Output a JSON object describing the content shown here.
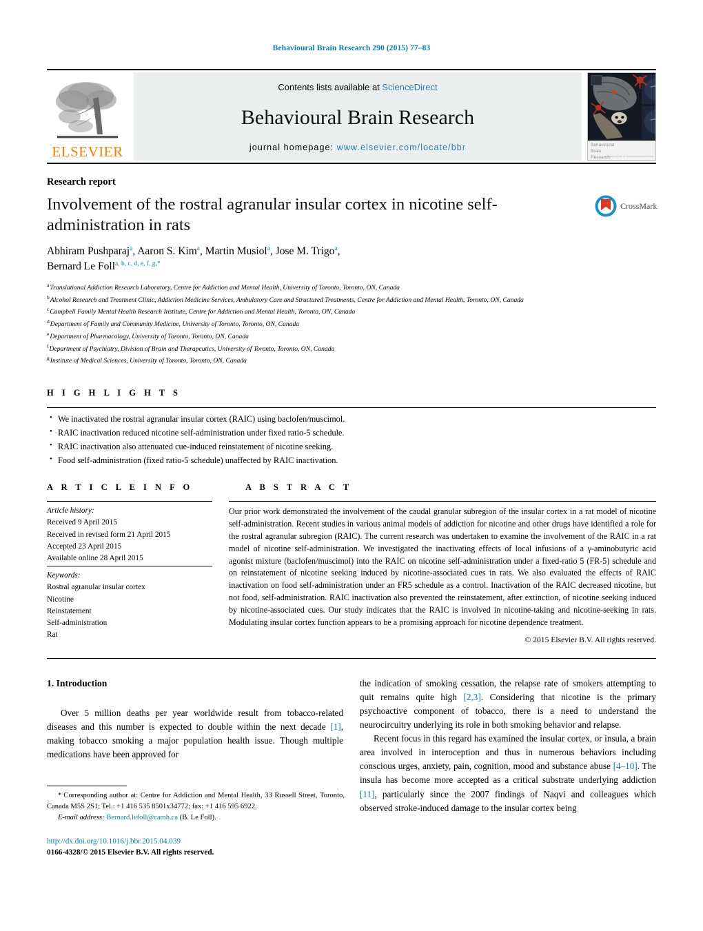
{
  "running_head": "Behavioural Brain Research 290 (2015) 77–83",
  "masthead": {
    "contents_prefix": "Contents lists available at ",
    "sciencedirect": "ScienceDirect",
    "journal_title": "Behavioural Brain Research",
    "homepage_label": "journal homepage:",
    "homepage_url": "www.elsevier.com/locate/bbr",
    "publisher_wordmark": "ELSEVIER",
    "cover_caption_line1": "Behavioural",
    "cover_caption_line2": "Brain",
    "cover_caption_line3": "Research",
    "cover_caption_tiny": "available online at www.sciencedirect.com"
  },
  "article": {
    "kind": "Research report",
    "title": "Involvement of the rostral agranular insular cortex in nicotine self-administration in rats",
    "crossmark_label": "CrossMark",
    "authors": [
      {
        "name": "Abhiram Pushparaj",
        "marks": "a",
        "sep": ", "
      },
      {
        "name": "Aaron S. Kim",
        "marks": "a",
        "sep": ", "
      },
      {
        "name": "Martin Musiol",
        "marks": "a",
        "sep": ", "
      },
      {
        "name": "Jose M. Trigo",
        "marks": "a",
        "sep": ","
      },
      {
        "name": "Bernard Le Foll",
        "marks": "a, b, c, d, e, f, g,",
        "sep": ""
      }
    ],
    "corresponding_mark": "*",
    "affiliations": [
      {
        "mark": "a",
        "text": "Translational Addiction Research Laboratory, Centre for Addiction and Mental Health, University of Toronto, Toronto, ON, Canada"
      },
      {
        "mark": "b",
        "text": "Alcohol Research and Treatment Clinic, Addiction Medicine Services, Ambulatory Care and Structured Treatments, Centre for Addiction and Mental Health, Toronto, ON, Canada"
      },
      {
        "mark": "c",
        "text": "Campbell Family Mental Health Research Institute, Centre for Addiction and Mental Health, Toronto, ON, Canada"
      },
      {
        "mark": "d",
        "text": "Department of Family and Community Medicine, University of Toronto, Toronto, ON, Canada"
      },
      {
        "mark": "e",
        "text": "Department of Pharmacology, University of Toronto, Toronto, ON, Canada"
      },
      {
        "mark": "f",
        "text": "Department of Psychiatry, Division of Brain and Therapeutics, University of Toronto, Toronto, ON, Canada"
      },
      {
        "mark": "g",
        "text": "Institute of Medical Sciences, University of Toronto, Toronto, ON, Canada"
      }
    ]
  },
  "highlights": {
    "heading": "H I G H L I G H T S",
    "items": [
      "We inactivated the rostral agranular insular cortex (RAIC) using baclofen/muscimol.",
      "RAIC inactivation reduced nicotine self-administration under fixed ratio-5 schedule.",
      "RAIC inactivation also attenuated cue-induced reinstatement of nicotine seeking.",
      "Food self-administration (fixed ratio-5 schedule) unaffected by RAIC inactivation."
    ]
  },
  "article_info": {
    "heading": "A R T I C L E   I N F O",
    "history_label": "Article history:",
    "history": [
      "Received 9 April 2015",
      "Received in revised form 21 April 2015",
      "Accepted 23 April 2015",
      "Available online 28 April 2015"
    ],
    "keywords_label": "Keywords:",
    "keywords": [
      "Rostral agranular insular cortex",
      "Nicotine",
      "Reinstatement",
      "Self-administration",
      "Rat"
    ]
  },
  "abstract": {
    "heading": "A B S T R A C T",
    "text": "Our prior work demonstrated the involvement of the caudal granular subregion of the insular cortex in a rat model of nicotine self-administration. Recent studies in various animal models of addiction for nicotine and other drugs have identified a role for the rostral agranular subregion (RAIC). The current research was undertaken to examine the involvement of the RAIC in a rat model of nicotine self-administration. We investigated the inactivating effects of local infusions of a γ-aminobutyric acid agonist mixture (baclofen/muscimol) into the RAIC on nicotine self-administration under a fixed-ratio 5 (FR-5) schedule and on reinstatement of nicotine seeking induced by nicotine-associated cues in rats. We also evaluated the effects of RAIC inactivation on food self-administration under an FR5 schedule as a control. Inactivation of the RAIC decreased nicotine, but not food, self-administration. RAIC inactivation also prevented the reinstatement, after extinction, of nicotine seeking induced by nicotine-associated cues. Our study indicates that the RAIC is involved in nicotine-taking and nicotine-seeking in rats. Modulating insular cortex function appears to be a promising approach for nicotine dependence treatment.",
    "copyright": "© 2015 Elsevier B.V. All rights reserved."
  },
  "introduction": {
    "heading": "1.  Introduction",
    "left_paragraph_1_a": "Over 5 million deaths per year worldwide result from tobacco-related diseases and this number is expected to double within the next decade ",
    "left_ref_1": "[1]",
    "left_paragraph_1_b": ", making tobacco smoking a major population health issue. Though multiple medications have been approved for",
    "right_paragraph_1_a": "the indication of smoking cessation, the relapse rate of smokers attempting to quit remains quite high ",
    "right_ref_1": "[2,3]",
    "right_paragraph_1_b": ". Considering that nicotine is the primary psychoactive component of tobacco, there is a need to understand the neurocircuitry underlying its role in both smoking behavior and relapse.",
    "right_paragraph_2_a": "Recent focus in this regard has examined the insular cortex, or insula, a brain area involved in interoception and thus in numerous behaviors including conscious urges, anxiety, pain, cognition, mood and substance abuse ",
    "right_ref_2": "[4–10]",
    "right_paragraph_2_b": ". The insula has become more accepted as a critical substrate underlying addiction ",
    "right_ref_3": "[11]",
    "right_paragraph_2_c": ", particularly since the 2007 findings of Naqvi and colleagues which observed stroke-induced damage to the insular cortex being"
  },
  "footnote": {
    "star": "*",
    "corresponding_text": "Corresponding author at: Centre for Addiction and Mental Health, 33 Russell Street, Toronto, Canada M5S 2S1; Tel.: +1 416 535 8501x34772; fax: +1 416 595 6922.",
    "email_label": "E-mail address:",
    "email": "Bernard.lefoll@camh.ca",
    "email_suffix": "(B. Le Foll)."
  },
  "doi_block": {
    "doi_url": "http://dx.doi.org/10.1016/j.bbr.2015.04.039",
    "issn_line": "0166-4328/© 2015 Elsevier B.V. All rights reserved."
  },
  "colors": {
    "link_blue": "#0b7ba5",
    "elsevier_orange": "#f08000",
    "masthead_gray": "#eceff0"
  }
}
